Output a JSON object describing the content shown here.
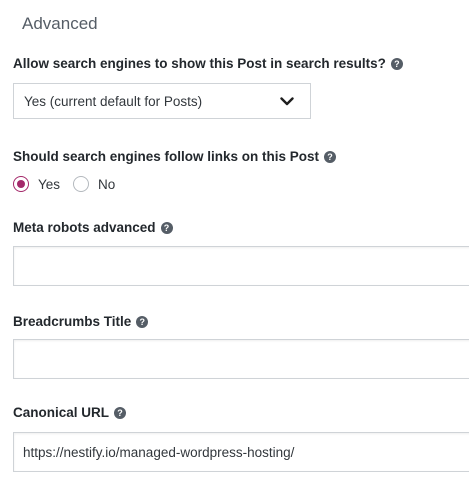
{
  "section": {
    "title": "Advanced"
  },
  "search_visibility": {
    "label": "Allow search engines to show this Post in search results?",
    "selected": "Yes (current default for Posts)"
  },
  "follow_links": {
    "label": "Should search engines follow links on this Post",
    "options": [
      {
        "label": "Yes",
        "checked": true
      },
      {
        "label": "No",
        "checked": false
      }
    ]
  },
  "meta_robots": {
    "label": "Meta robots advanced",
    "value": ""
  },
  "breadcrumbs_title": {
    "label": "Breadcrumbs Title",
    "value": ""
  },
  "canonical_url": {
    "label": "Canonical URL",
    "value": "https://nestify.io/managed-wordpress-hosting/"
  },
  "icons": {
    "help": "help-icon",
    "dropdown": "chevron-down-icon"
  },
  "colors": {
    "accent": "#a4286a",
    "border": "#cfd3d7",
    "label_text": "#23282d",
    "heading_text": "#555d66"
  }
}
